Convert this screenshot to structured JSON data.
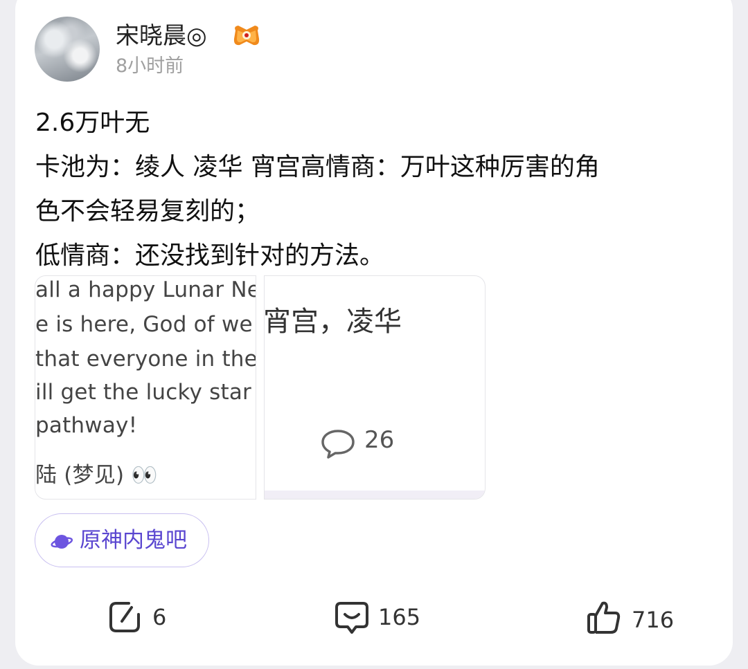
{
  "post": {
    "author": "宋晓晨◎",
    "time": "8小时前",
    "lines": [
      "2.6万叶无",
      "卡池为：绫人 凌华 宵宫高情商：万叶这种厉害的角",
      "色不会轻易复刻的；",
      "低情商：还没找到针对的方法。"
    ]
  },
  "images": {
    "left_lines": [
      "all a happy Lunar Ne",
      "e is here, God of we",
      " that everyone in the",
      "ill get the lucky star",
      " pathway!",
      "陆 (梦见) 👀"
    ],
    "right_title": "宵宫，凌华",
    "right_comment_count": "26"
  },
  "topic": {
    "label": "原神内鬼吧"
  },
  "actions": {
    "share_count": "6",
    "comment_count": "165",
    "like_count": "716"
  },
  "colors": {
    "accent": "#5a46d0",
    "topic_border": "#c8bff0",
    "background": "#eeeef2"
  }
}
